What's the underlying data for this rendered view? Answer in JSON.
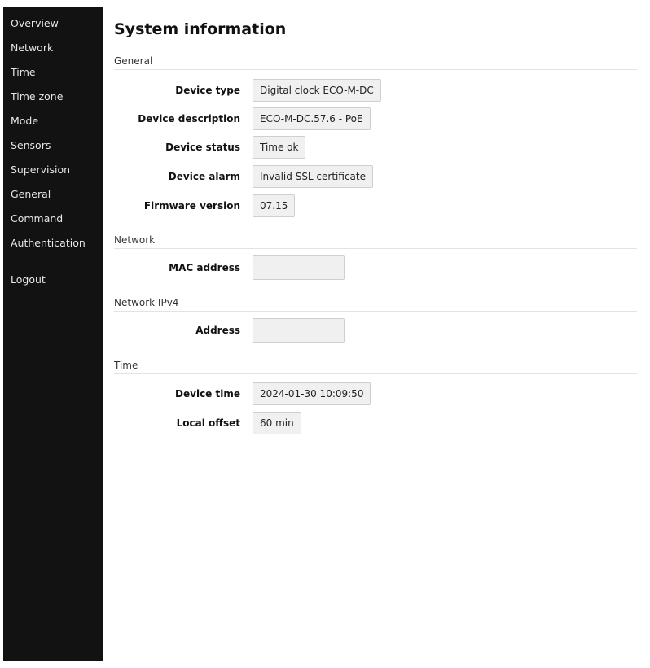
{
  "sidebar": {
    "items": [
      {
        "label": "Overview"
      },
      {
        "label": "Network"
      },
      {
        "label": "Time"
      },
      {
        "label": "Time zone"
      },
      {
        "label": "Mode"
      },
      {
        "label": "Sensors"
      },
      {
        "label": "Supervision"
      },
      {
        "label": "General"
      },
      {
        "label": "Command"
      },
      {
        "label": "Authentication"
      }
    ],
    "logout_label": "Logout"
  },
  "page": {
    "title": "System information"
  },
  "sections": {
    "general": {
      "header": "General",
      "device_type": {
        "label": "Device type",
        "value": "Digital clock ECO-M-DC"
      },
      "device_description": {
        "label": "Device description",
        "value": "ECO-M-DC.57.6 - PoE"
      },
      "device_status": {
        "label": "Device status",
        "value": "Time ok"
      },
      "device_alarm": {
        "label": "Device alarm",
        "value": "Invalid SSL certificate"
      },
      "firmware_version": {
        "label": "Firmware version",
        "value": "07.15"
      }
    },
    "network": {
      "header": "Network",
      "mac_address": {
        "label": "MAC address",
        "value": ""
      }
    },
    "network_ipv4": {
      "header": "Network IPv4",
      "address": {
        "label": "Address",
        "value": ""
      }
    },
    "time": {
      "header": "Time",
      "device_time": {
        "label": "Device time",
        "value": "2024-01-30 10:09:50"
      },
      "local_offset": {
        "label": "Local offset",
        "value": "60 min"
      }
    }
  },
  "colors": {
    "sidebar_bg": "#121212",
    "sidebar_text": "#e6e6e6",
    "value_box_bg": "#f0f0f0",
    "value_box_border": "#cfcfcf"
  }
}
